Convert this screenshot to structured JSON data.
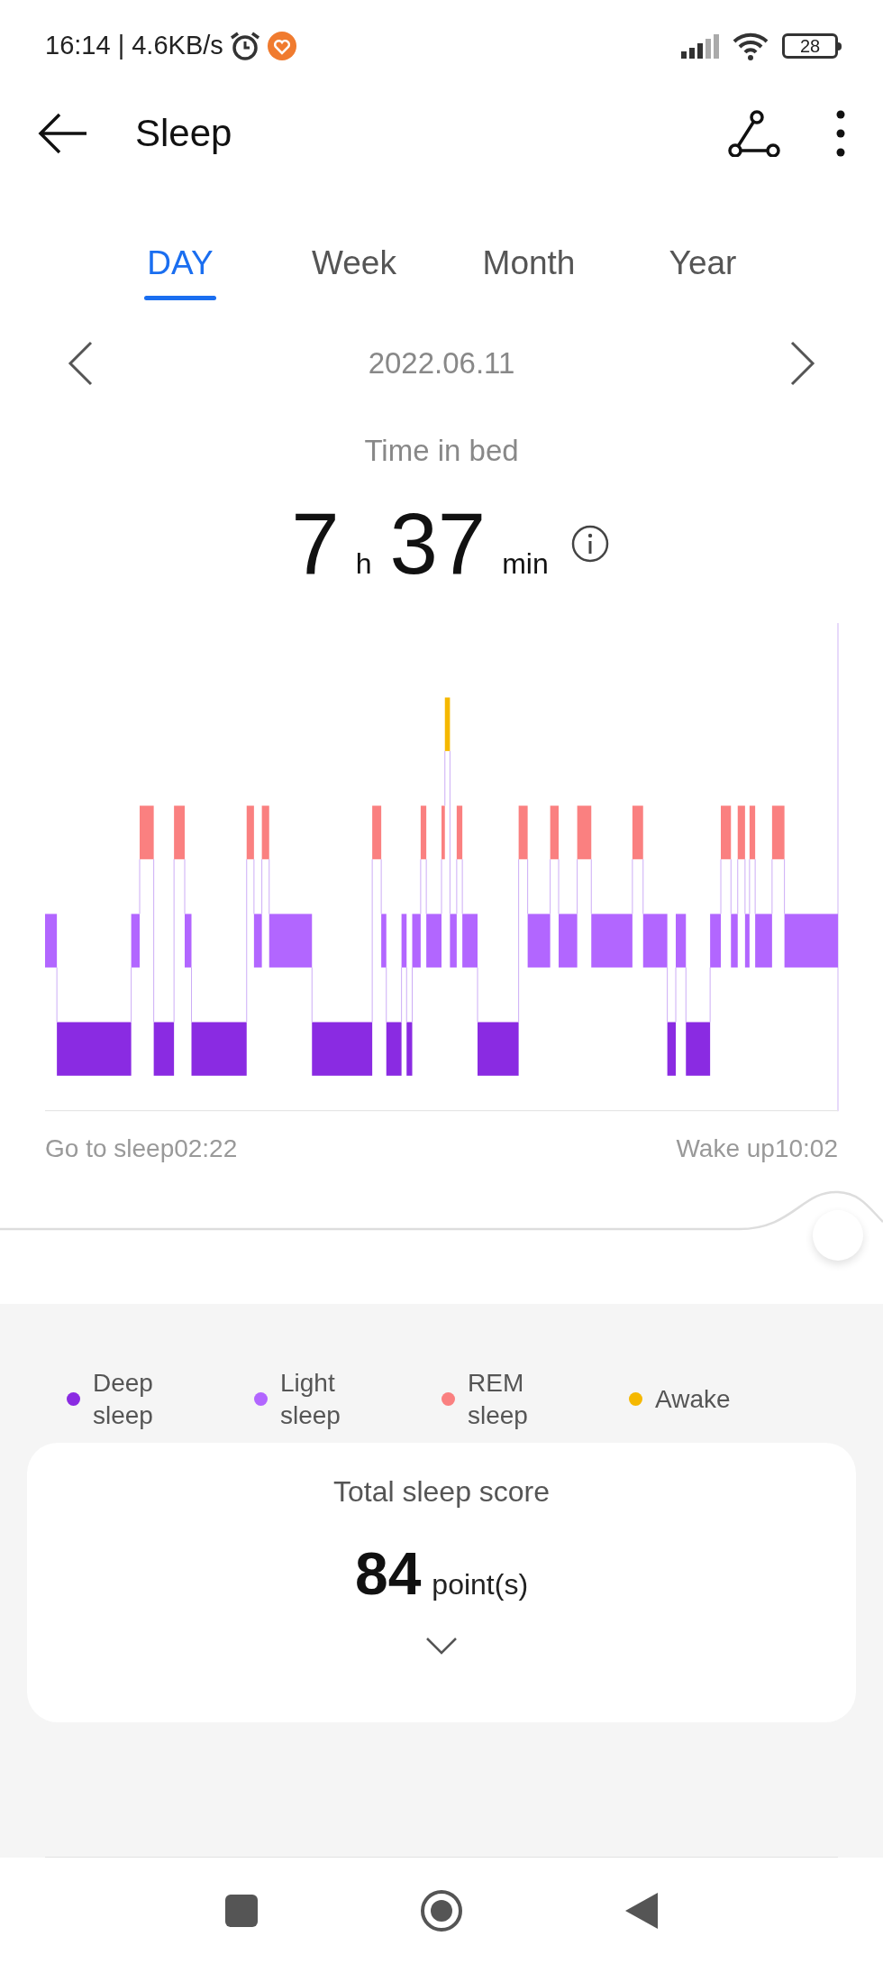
{
  "status_bar": {
    "time_speed": "16:14 | 4.6KB/s",
    "battery": "28"
  },
  "header": {
    "title": "Sleep"
  },
  "tabs": [
    {
      "label": "DAY",
      "selected": true
    },
    {
      "label": "Week",
      "selected": false
    },
    {
      "label": "Month",
      "selected": false
    },
    {
      "label": "Year",
      "selected": false
    }
  ],
  "date_nav": {
    "date": "2022.06.11"
  },
  "summary": {
    "label": "Time in bed",
    "hours": "7",
    "hours_unit": "h",
    "minutes": "37",
    "minutes_unit": "min"
  },
  "chart": {
    "start_label": "Go to sleep02:22",
    "end_label": "Wake up10:02"
  },
  "legend": [
    {
      "label": "Deep sleep",
      "color": "#8a2be2"
    },
    {
      "label": "Light sleep",
      "color": "#b266ff"
    },
    {
      "label": "REM sleep",
      "color": "#fa8080"
    },
    {
      "label": "Awake",
      "color": "#f5b800"
    }
  ],
  "score_card": {
    "title": "Total sleep score",
    "score": "84",
    "unit": "point(s)"
  }
}
